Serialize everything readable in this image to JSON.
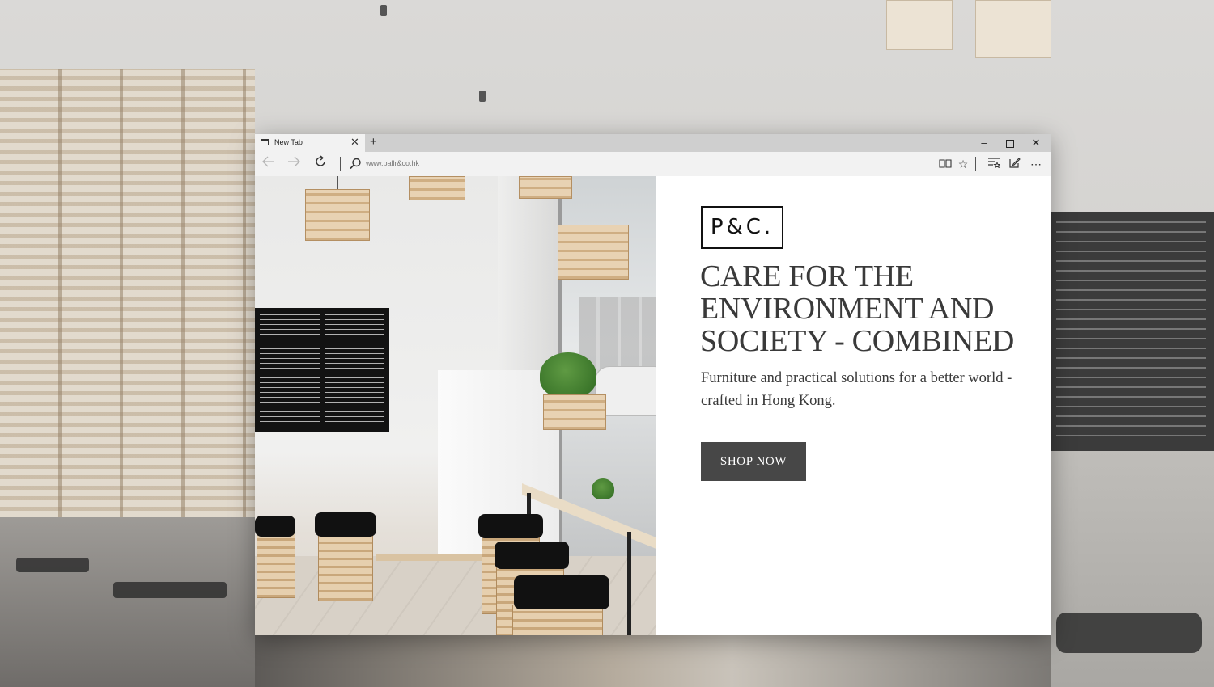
{
  "browser": {
    "tab_title": "New Tab",
    "new_tab_label": "+",
    "tab_close_glyph": "✕",
    "address": "www.pallr&co.hk",
    "controls": {
      "minimize": "–",
      "close": "✕"
    },
    "toolbar_icons": [
      "reading-view-icon",
      "favorite-star-icon",
      "web-note-icon",
      "share-icon",
      "more-icon"
    ],
    "nav_icons": [
      "back-arrow-icon",
      "forward-arrow-icon",
      "refresh-icon",
      "search-icon"
    ]
  },
  "hero": {
    "logo_text": "P&C.",
    "headline": "CARE FOR THE ENVIRONMENT AND SOCIETY - COMBINED",
    "subheadline": "Furniture and practical solutions for a better world - crafted in Hong Kong.",
    "cta_label": "SHOP NOW"
  },
  "colors": {
    "cta_background": "#474747",
    "headline_text": "#3a3a3a",
    "tab_bar": "#cfcfcf",
    "address_bar": "#f2f2f2"
  }
}
